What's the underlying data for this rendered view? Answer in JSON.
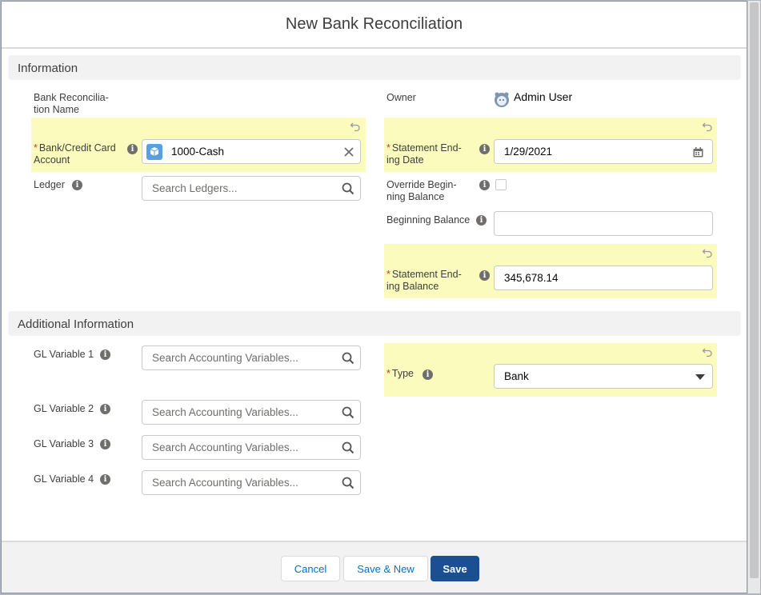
{
  "modal": {
    "title": "New Bank Reconciliation"
  },
  "sections": {
    "information": "Information",
    "additional": "Additional Information"
  },
  "fields": {
    "name": {
      "label_line1": "Bank Reconcilia-",
      "label_line2": "tion Name"
    },
    "owner": {
      "label": "Owner",
      "value": "Admin User",
      "icon": "user-avatar-icon"
    },
    "bank_account": {
      "required": "*",
      "label_line1": "Bank/Credit Card",
      "label_line2": "Account",
      "value": "1000-Cash",
      "icon": "bank-account-icon"
    },
    "statement_ending_date": {
      "required": "*",
      "label_line1": "Statement End-",
      "label_line2": "ing Date",
      "value": "1/29/2021",
      "icon": "calendar-icon"
    },
    "ledger": {
      "label": "Ledger",
      "placeholder": "Search Ledgers..."
    },
    "override_beginning_balance": {
      "label_line1": "Override Begin-",
      "label_line2": "ning Balance",
      "checked": false
    },
    "beginning_balance": {
      "label": "Beginning Balance",
      "value": ""
    },
    "statement_ending_balance": {
      "required": "*",
      "label_line1": "Statement End-",
      "label_line2": "ing Balance",
      "value": "345,678.14"
    },
    "gl_variable_1": {
      "label": "GL Variable 1",
      "placeholder": "Search Accounting Variables..."
    },
    "gl_variable_2": {
      "label": "GL Variable 2",
      "placeholder": "Search Accounting Variables..."
    },
    "gl_variable_3": {
      "label": "GL Variable 3",
      "placeholder": "Search Accounting Variables..."
    },
    "gl_variable_4": {
      "label": "GL Variable 4",
      "placeholder": "Search Accounting Variables..."
    },
    "type": {
      "required": "*",
      "label": "Type",
      "value": "Bank"
    }
  },
  "info_glyph": "i",
  "footer": {
    "cancel": "Cancel",
    "save_new": "Save & New",
    "save": "Save"
  },
  "colors": {
    "highlight": "#fbfbbe",
    "brand": "#1b4f93",
    "link": "#0070d2",
    "required": "#c23934"
  }
}
